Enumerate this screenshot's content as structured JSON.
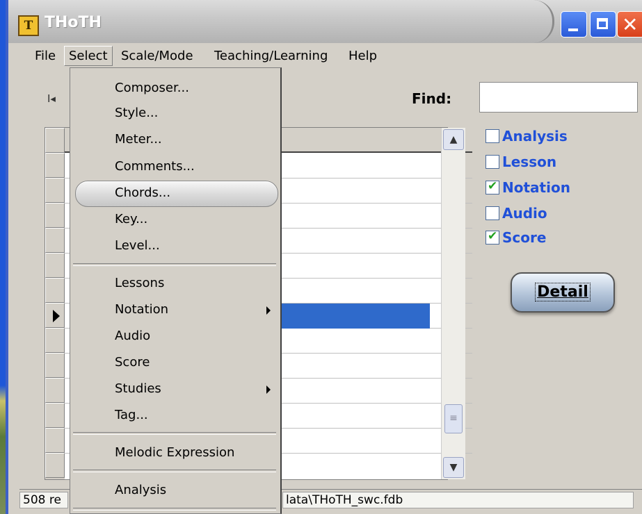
{
  "window": {
    "title": "THoTH",
    "app_icon_glyph": "T",
    "controls": {
      "minimize_icon": "minimize-icon",
      "maximize_icon": "maximize-icon",
      "close_icon": "close-icon",
      "close_glyph": "✕"
    }
  },
  "menubar": {
    "items": [
      "File",
      "Select",
      "Scale/Mode",
      "Teaching/Learning",
      "Help"
    ],
    "active": "Select"
  },
  "toolbar": {
    "nav_marker": "I◂",
    "find_label": "Find:",
    "find_value": ""
  },
  "select_menu": {
    "items": [
      "Composer...",
      "Style...",
      "Meter...",
      "Comments...",
      "Chords...",
      "Key...",
      "Level...",
      "Lessons",
      "Notation",
      "Audio",
      "Score",
      "Studies",
      "Tag...",
      "Melodic Expression",
      "Analysis"
    ],
    "highlighted": "Chords...",
    "submenus": [
      "Notation",
      "Studies"
    ]
  },
  "filters": {
    "items": [
      {
        "label": "Analysis",
        "checked": false
      },
      {
        "label": "Lesson",
        "checked": false
      },
      {
        "label": "Notation",
        "checked": true
      },
      {
        "label": "Audio",
        "checked": false
      },
      {
        "label": "Score",
        "checked": true
      }
    ],
    "check_glyph": "✔"
  },
  "detail_button": {
    "label": "Detail"
  },
  "grid": {
    "current_row_index": 7,
    "scroll_up_glyph": "▲",
    "scroll_down_glyph": "▼",
    "scroll_thumb_glyph": "≡"
  },
  "statusbar": {
    "record_count": "508 re",
    "path": "lata\\THoTH_swc.fdb"
  },
  "colors": {
    "accent": "#2050d8",
    "selection": "#2f6acb",
    "check": "#21a121"
  }
}
